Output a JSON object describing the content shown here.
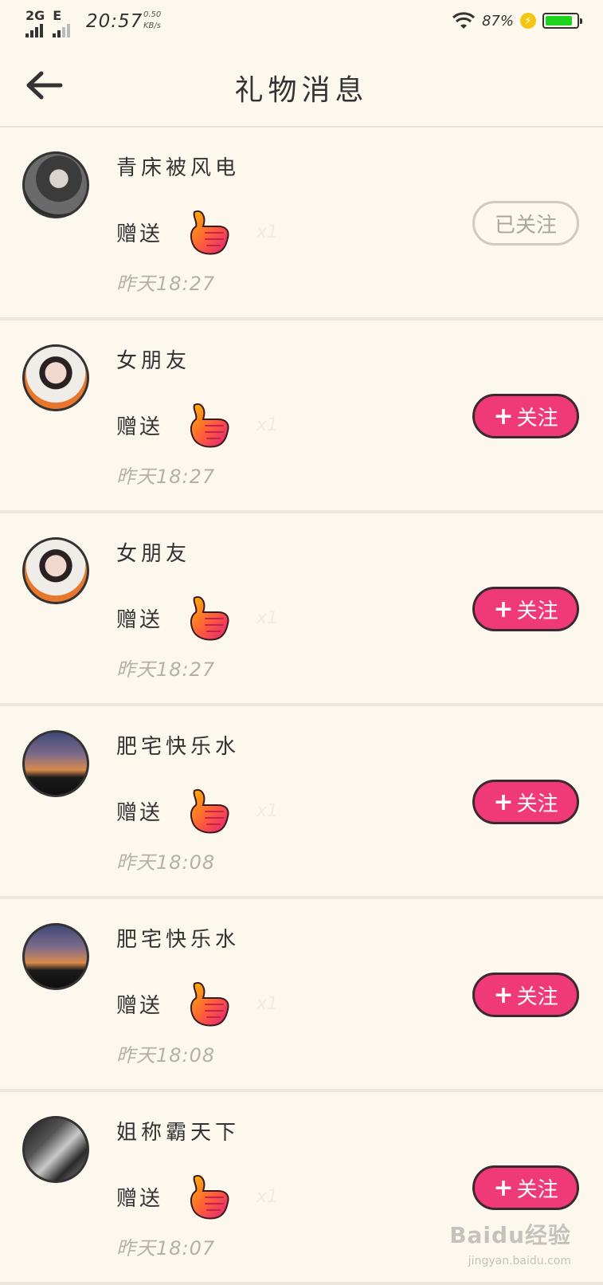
{
  "status_bar": {
    "network_1": "2G",
    "network_2": "E",
    "time": "20:57",
    "speed_value": "0.50",
    "speed_unit": "KB/s",
    "battery_percent": "87%",
    "battery_level": 0.87,
    "battery_color": "#1fd41f",
    "charge_icon": "lightning-icon",
    "wifi_icon": "wifi-icon"
  },
  "header": {
    "title": "礼物消息",
    "back_icon": "arrow-left-icon"
  },
  "gift_label": "赠送",
  "gift_icon": "thumbs-up-icon",
  "gift_count_mark": "x1",
  "items": [
    {
      "name": "青床被风电",
      "time": "昨天18:27",
      "button": "已关注",
      "followed": true,
      "avatar": "a1"
    },
    {
      "name": "女朋友",
      "time": "昨天18:27",
      "button": "关注",
      "followed": false,
      "avatar": "a2"
    },
    {
      "name": "女朋友",
      "time": "昨天18:27",
      "button": "关注",
      "followed": false,
      "avatar": "a2"
    },
    {
      "name": "肥宅快乐水",
      "time": "昨天18:08",
      "button": "关注",
      "followed": false,
      "avatar": "a3"
    },
    {
      "name": "肥宅快乐水",
      "time": "昨天18:08",
      "button": "关注",
      "followed": false,
      "avatar": "a3"
    },
    {
      "name": "姐称霸天下",
      "time": "昨天18:07",
      "button": "关注",
      "followed": false,
      "avatar": "a4"
    }
  ],
  "follow_plus": "+",
  "watermark": {
    "main": "Baidu经验",
    "sub": "jingyan.baidu.com"
  },
  "colors": {
    "background": "#fdf8ee",
    "follow_accent": "#f03a78",
    "followed_text": "#aaa59e",
    "time_text": "#b5b0a8"
  }
}
